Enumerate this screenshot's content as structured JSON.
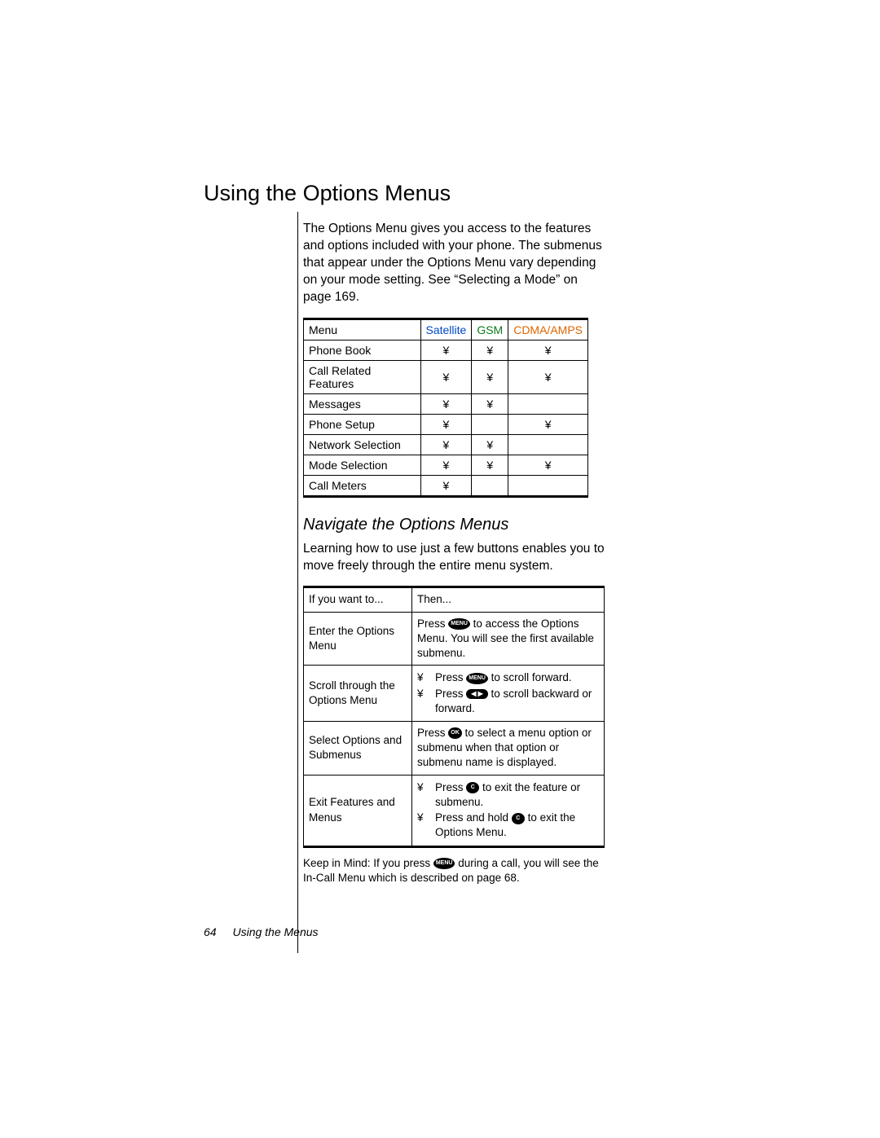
{
  "title": "Using the Options Menus",
  "intro": "The Options Menu gives you access to the features and options included with your phone. The submenus that appear under the Options Menu vary depending on your mode setting. See “Selecting a Mode” on page 169.",
  "modes_table": {
    "headers": [
      "Menu",
      "Satellite",
      "GSM",
      "CDMA/AMPS"
    ],
    "rows": [
      {
        "label": "Phone Book",
        "sat": "¥",
        "gsm": "¥",
        "cdma": "¥"
      },
      {
        "label": "Call Related Features",
        "sat": "¥",
        "gsm": "¥",
        "cdma": "¥"
      },
      {
        "label": "Messages",
        "sat": "¥",
        "gsm": "¥",
        "cdma": ""
      },
      {
        "label": "Phone Setup",
        "sat": "¥",
        "gsm": "",
        "cdma": "¥"
      },
      {
        "label": "Network Selection",
        "sat": "¥",
        "gsm": "¥",
        "cdma": ""
      },
      {
        "label": "Mode Selection",
        "sat": "¥",
        "gsm": "¥",
        "cdma": "¥"
      },
      {
        "label": "Call Meters",
        "sat": "¥",
        "gsm": "",
        "cdma": ""
      }
    ]
  },
  "subhead": "Navigate the Options Menus",
  "subintro": "Learning how to use just a few buttons enables you to move freely through the entire menu system.",
  "nav_table": {
    "headers": [
      "If you want to...",
      "Then..."
    ],
    "rows": [
      {
        "left": "Enter the Options Menu",
        "right_pre": "Press ",
        "right_btn": "MENU",
        "right_post": " to access the Options Menu. You will see the ﬁrst available submenu."
      },
      {
        "left": "Scroll through the Options Menu",
        "bullets": [
          {
            "pre": "Press ",
            "btn": "MENU",
            "post": " to scroll forward."
          },
          {
            "pre": "Press ",
            "btn": "◀ ▶",
            "btn_wide": true,
            "post": " to scroll backward or forward."
          }
        ]
      },
      {
        "left": "Select Options and Submenus",
        "right_pre": "Press ",
        "right_btn": "OK",
        "right_post": " to select a menu option or submenu when that option or submenu name is displayed."
      },
      {
        "left": "Exit Features and Menus",
        "bullets": [
          {
            "pre": "Press ",
            "btn": "C",
            "post": " to exit the feature or submenu."
          },
          {
            "pre": "Press and hold ",
            "btn": "C",
            "post": " to exit the Options Menu."
          }
        ]
      }
    ]
  },
  "note_pre": "Keep in Mind:  If you press ",
  "note_btn": "MENU",
  "note_post": " during a call, you will see the In-Call Menu which is described on page 68.",
  "footer_page": "64",
  "footer_text": "Using the Menus",
  "bullet_mark": "¥",
  "chart_data": {
    "type": "table",
    "title": "Options Menu availability by mode",
    "columns": [
      "Menu",
      "Satellite",
      "GSM",
      "CDMA/AMPS"
    ],
    "rows": [
      [
        "Phone Book",
        true,
        true,
        true
      ],
      [
        "Call Related Features",
        true,
        true,
        true
      ],
      [
        "Messages",
        true,
        true,
        false
      ],
      [
        "Phone Setup",
        true,
        false,
        true
      ],
      [
        "Network Selection",
        true,
        true,
        false
      ],
      [
        "Mode Selection",
        true,
        true,
        true
      ],
      [
        "Call Meters",
        true,
        false,
        false
      ]
    ]
  }
}
